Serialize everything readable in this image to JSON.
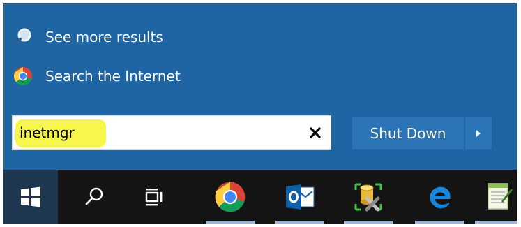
{
  "start_menu": {
    "results": [
      {
        "label": "See more results",
        "icon": "search-icon"
      },
      {
        "label": "Search the Internet",
        "icon": "chrome-icon"
      }
    ],
    "search": {
      "value": "inetmgr",
      "placeholder": ""
    },
    "power": {
      "label": "Shut Down"
    }
  },
  "taskbar": {
    "items": [
      {
        "icon": "windows-start-icon"
      },
      {
        "icon": "search-icon"
      },
      {
        "icon": "task-view-icon"
      },
      {
        "icon": "chrome-icon"
      },
      {
        "icon": "outlook-icon"
      },
      {
        "icon": "database-tools-icon"
      },
      {
        "icon": "edge-icon"
      },
      {
        "icon": "notepad-icon"
      }
    ]
  },
  "colors": {
    "panel": "#1f65a4",
    "taskbar": "#141414",
    "highlight": "#f5f542"
  }
}
